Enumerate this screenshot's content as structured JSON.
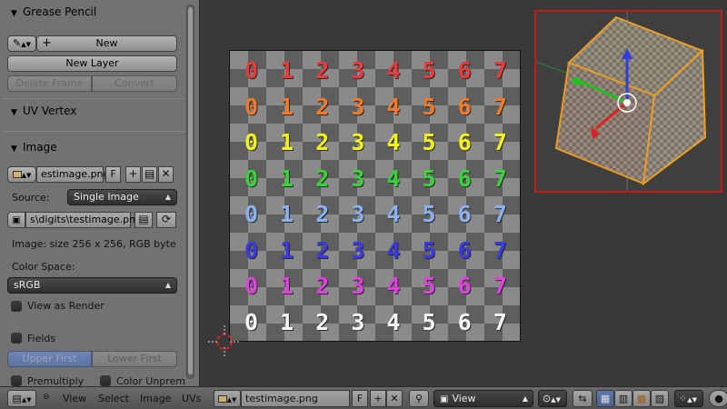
{
  "sidebar": {
    "grease_pencil": {
      "title": "Grease Pencil",
      "new_label": "New",
      "new_layer_label": "New Layer",
      "delete_frame_label": "Delete Frame",
      "convert_label": "Convert"
    },
    "uv_vertex": {
      "title": "UV Vertex"
    },
    "image": {
      "title": "Image",
      "image_name": "estimage.png",
      "fake_user_label": "F",
      "source_label": "Source:",
      "source_value": "Single Image",
      "filepath": "s\\digits\\testimage.png",
      "info": "Image: size 256 x 256, RGB byte",
      "color_space_label": "Color Space:",
      "color_space_value": "sRGB",
      "view_as_render_label": "View as Render",
      "fields_label": "Fields",
      "upper_first_label": "Upper First",
      "lower_first_label": "Lower First",
      "premultiply_label": "Premultiply",
      "color_unpremultiply_label": "Color Unprem"
    }
  },
  "uv_image": {
    "digit_row": [
      "0",
      "1",
      "2",
      "3",
      "4",
      "5",
      "6",
      "7"
    ],
    "row_colors": [
      "#e53b3b",
      "#f07a2a",
      "#f2f21a",
      "#3ad23a",
      "#8ab0ee",
      "#3a3ae0",
      "#e040e0",
      "#f5f5f5"
    ]
  },
  "header": {
    "menus": [
      "View",
      "Select",
      "Image",
      "UVs"
    ],
    "image_name": "testimage.png",
    "fake_user_label": "F",
    "view_mode": "View"
  },
  "colors": {
    "sidebar_bg": "#727272",
    "viewport_bg": "#393939",
    "preview_border": "#c41a1a",
    "selection_orange": "#f0a020"
  }
}
